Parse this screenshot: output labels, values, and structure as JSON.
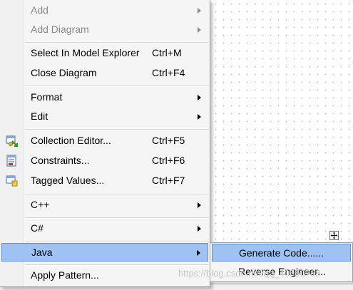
{
  "menu": {
    "items": [
      {
        "label": "Add",
        "shortcut": "",
        "submenu": true,
        "disabled": true
      },
      {
        "label": "Add Diagram",
        "shortcut": "",
        "submenu": true,
        "disabled": true
      },
      {
        "label": "Select In Model Explorer",
        "shortcut": "Ctrl+M"
      },
      {
        "label": "Close Diagram",
        "shortcut": "Ctrl+F4"
      },
      {
        "label": "Format",
        "shortcut": "",
        "submenu": true
      },
      {
        "label": "Edit",
        "shortcut": "",
        "submenu": true
      },
      {
        "label": "Collection Editor...",
        "shortcut": "Ctrl+F5",
        "icon": "collection-editor-icon"
      },
      {
        "label": "Constraints...",
        "shortcut": "Ctrl+F6",
        "icon": "constraints-icon"
      },
      {
        "label": "Tagged Values...",
        "shortcut": "Ctrl+F7",
        "icon": "tagged-values-icon"
      },
      {
        "label": "C++",
        "shortcut": "",
        "submenu": true
      },
      {
        "label": "C#",
        "shortcut": "",
        "submenu": true
      },
      {
        "label": "Java",
        "shortcut": "",
        "submenu": true,
        "selected": true
      },
      {
        "label": "Apply Pattern...",
        "shortcut": ""
      }
    ]
  },
  "submenu": {
    "items": [
      {
        "label": "Generate Code......",
        "selected": true
      },
      {
        "label": "Reverse Engineer..."
      }
    ]
  },
  "watermark": "https://blog.csdn.net/qq_40550768",
  "colors": {
    "selection": "#9ec3f3",
    "selection_border": "#5b93d8",
    "menu_bg": "#f5f5f5"
  }
}
